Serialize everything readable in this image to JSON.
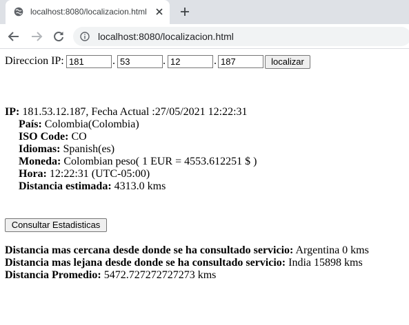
{
  "browser": {
    "tab_title": "localhost:8080/localizacion.html",
    "url": "localhost:8080/localizacion.html"
  },
  "form": {
    "label": "Direccion IP:",
    "octets": [
      "181",
      "53",
      "12",
      "187"
    ],
    "separator": ".",
    "locate_button": "localizar"
  },
  "result": {
    "ip_label": "IP:",
    "ip_value": " 181.53.12.187, Fecha Actual :27/05/2021 12:22:31",
    "fields": [
      {
        "label": "País:",
        "value": " Colombia(Colombia)"
      },
      {
        "label": "ISO Code:",
        "value": " CO"
      },
      {
        "label": "Idiomas:",
        "value": " Spanish(es)"
      },
      {
        "label": "Moneda:",
        "value": " Colombian peso( 1 EUR = 4553.612251 $ )"
      },
      {
        "label": "Hora:",
        "value": " 12:22:31 (UTC-05:00)"
      },
      {
        "label": "Distancia estimada:",
        "value": " 4313.0 kms"
      }
    ]
  },
  "stats_button": "Consultar Estadisticas",
  "stats": [
    {
      "label": "Distancia mas cercana desde donde se ha consultado servicio:",
      "value": " Argentina 0 kms"
    },
    {
      "label": "Distancia mas lejana desde donde se ha consultado servicio:",
      "value": " India 15898 kms"
    },
    {
      "label": "Distancia Promedio:",
      "value": " 5472.727272727273 kms"
    }
  ]
}
